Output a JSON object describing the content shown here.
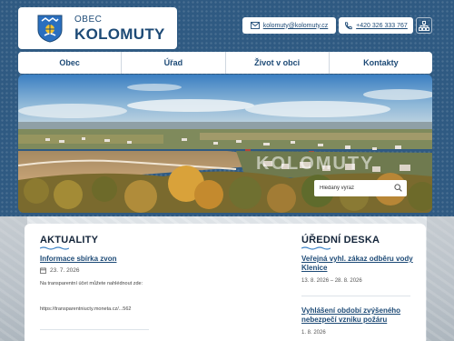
{
  "header": {
    "logo_small": "OBEC",
    "logo_big": "KOLOMUTY",
    "email": "kolomuty@kolomuty.cz",
    "phone": "+420 326 333 767"
  },
  "nav": {
    "items": [
      "Obec",
      "Úřad",
      "Život v obci",
      "Kontakty"
    ]
  },
  "hero": {
    "watermark": "KOLOMUTY",
    "search_placeholder": "Hledaný výraz"
  },
  "news": {
    "heading": "AKTUALITY",
    "item": {
      "title": "Informace sbírka zvon",
      "date": "23. 7. 2026",
      "text": "Na transparentní účet můžete nahlédnout zde:",
      "link": "https://transparentniucty.moneta.cz/...562"
    }
  },
  "board": {
    "heading": "ÚŘEDNÍ DESKA",
    "items": [
      {
        "title": "Veřejná vyhl. zákaz odběru vody Klenice",
        "date": "13. 8. 2026 – 28. 8. 2026"
      },
      {
        "title": "Vyhlášení období zvýšeného nebezpečí vzniku požáru",
        "date": "1. 8. 2026"
      }
    ]
  },
  "colors": {
    "brand": "#1d4a76",
    "page_bg": "#2f5a82"
  },
  "icons": [
    "crest-icon",
    "mail-icon",
    "phone-icon",
    "sitemap-icon",
    "search-icon",
    "calendar-icon"
  ]
}
